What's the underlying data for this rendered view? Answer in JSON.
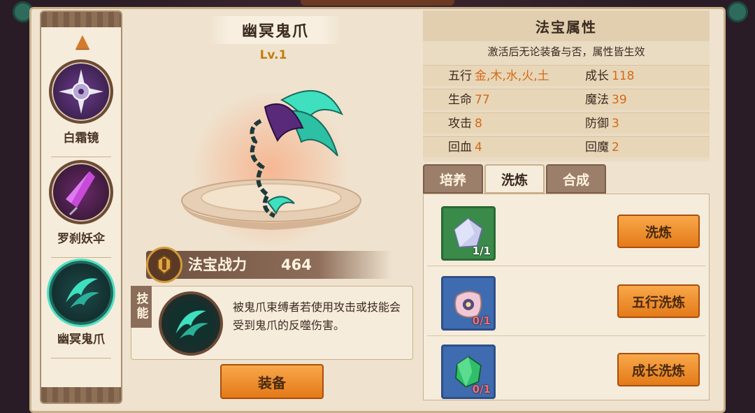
{
  "left_list": {
    "up_icon": "chevron-up-icon",
    "items": [
      {
        "label": "白霜镜"
      },
      {
        "label": "罗刹妖伞"
      },
      {
        "label": "幽冥鬼爪"
      }
    ]
  },
  "treasure": {
    "name": "幽冥鬼爪",
    "level": "Lv.1",
    "power_label": "法宝战力",
    "power_value": "464"
  },
  "skill": {
    "tag": "技能",
    "description": "被鬼爪束缚者若使用攻击或技能会受到鬼爪的反噬伤害。"
  },
  "equip_button": "装备",
  "attributes": {
    "title": "法宝属性",
    "subtitle": "激活后无论装备与否，属性皆生效",
    "rows": [
      [
        {
          "k": "五行",
          "v": "金,木,水,火,土"
        },
        {
          "k": "成长",
          "v": "118"
        }
      ],
      [
        {
          "k": "生命",
          "v": "77"
        },
        {
          "k": "魔法",
          "v": "39"
        }
      ],
      [
        {
          "k": "攻击",
          "v": "8"
        },
        {
          "k": "防御",
          "v": "3"
        }
      ],
      [
        {
          "k": "回血",
          "v": "4"
        },
        {
          "k": "回魔",
          "v": "2"
        }
      ]
    ]
  },
  "tabs": [
    {
      "label": "培养"
    },
    {
      "label": "洗炼"
    },
    {
      "label": "合成"
    }
  ],
  "wash": [
    {
      "count": "1/1",
      "button": "洗炼",
      "icon": "silver-crystal-icon"
    },
    {
      "count": "0/1",
      "button": "五行洗炼",
      "icon": "five-elements-stone-icon"
    },
    {
      "count": "0/1",
      "button": "成长洗炼",
      "icon": "emerald-gem-icon"
    }
  ]
}
